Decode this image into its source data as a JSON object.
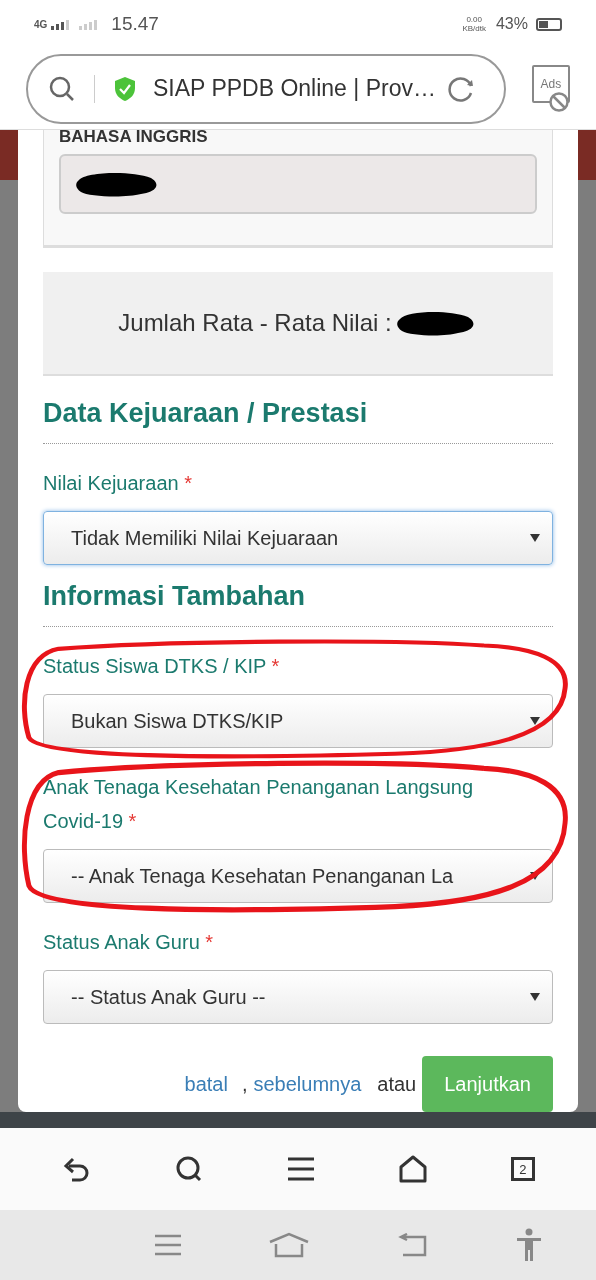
{
  "status_bar": {
    "network": "4G",
    "time": "15.47",
    "speed_value": "0.00",
    "speed_unit": "KB/dtk",
    "battery": "43%"
  },
  "url_bar": {
    "title": "SIAP PPDB Online | Prov…",
    "ads_label": "Ads"
  },
  "form": {
    "score_field": {
      "label": "BAHASA INGGRIS",
      "redacted": true
    },
    "average": {
      "label": "Jumlah Rata - Rata Nilai :",
      "redacted": true
    },
    "sections": [
      {
        "heading": "Data Kejuaraan / Prestasi",
        "fields": [
          {
            "label": "Nilai Kejuaraan",
            "required_mark": "*",
            "value": "Tidak Memiliki Nilai Kejuaraan",
            "focused": true,
            "circled": false
          }
        ]
      },
      {
        "heading": "Informasi Tambahan",
        "fields": [
          {
            "label": "Status Siswa DTKS / KIP",
            "required_mark": "*",
            "value": "Bukan Siswa DTKS/KIP",
            "focused": false,
            "circled": true
          },
          {
            "label": "Anak Tenaga Kesehatan Penanganan Langsung Covid-19",
            "required_mark": "*",
            "value": "-- Anak Tenaga Kesehatan Penanganan La",
            "focused": false,
            "circled": true
          },
          {
            "label": "Status Anak Guru",
            "required_mark": "*",
            "value": "-- Status Anak Guru --",
            "focused": false,
            "circled": false
          }
        ]
      }
    ],
    "footer": {
      "cancel_link": "batal",
      "separator": ",",
      "back_link": "sebelumnya",
      "or_text": "atau",
      "next_button": "Lanjutkan"
    }
  },
  "toolbar": {
    "tab_count": "2"
  }
}
